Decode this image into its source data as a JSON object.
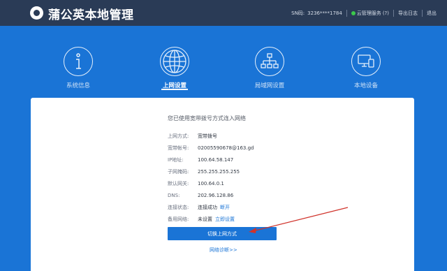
{
  "header": {
    "title": "蒲公英本地管理",
    "sn_label": "SN码:",
    "sn_value": "3236****1784",
    "cloud_label": "云管理服务",
    "cloud_help": "(?)",
    "export_log": "导出日志",
    "logout": "退出"
  },
  "nav": {
    "items": [
      {
        "label": "系统信息",
        "icon": "info-icon"
      },
      {
        "label": "上网设置",
        "icon": "globe-icon"
      },
      {
        "label": "局域网设置",
        "icon": "network-tree-icon"
      },
      {
        "label": "本地设备",
        "icon": "devices-icon"
      }
    ],
    "active_index": 1
  },
  "main": {
    "intro": "您已使用宽带拨号方式连入网络",
    "rows": [
      {
        "label": "上网方式:",
        "value": "宽带拨号"
      },
      {
        "label": "宽带帐号:",
        "value": "02005590678@163.gd"
      },
      {
        "label": "IP地址:",
        "value": "100.64.58.147"
      },
      {
        "label": "子网掩码:",
        "value": "255.255.255.255"
      },
      {
        "label": "默认网关:",
        "value": "100.64.0.1"
      },
      {
        "label": "DNS:",
        "value": "202.96.128.86"
      },
      {
        "label": "连接状态:",
        "value": "连接成功",
        "action": "断开"
      },
      {
        "label": "备用网络:",
        "value": "未设置",
        "action": "立即设置"
      }
    ],
    "switch_button": "切换上网方式",
    "diagnose_link": "网络诊断>>"
  },
  "colors": {
    "background": "#1a74d6",
    "topbar": "#2a3b56",
    "accent": "#1a74d6",
    "status_online": "#3cc84b",
    "annotation_arrow": "#d0332b"
  }
}
